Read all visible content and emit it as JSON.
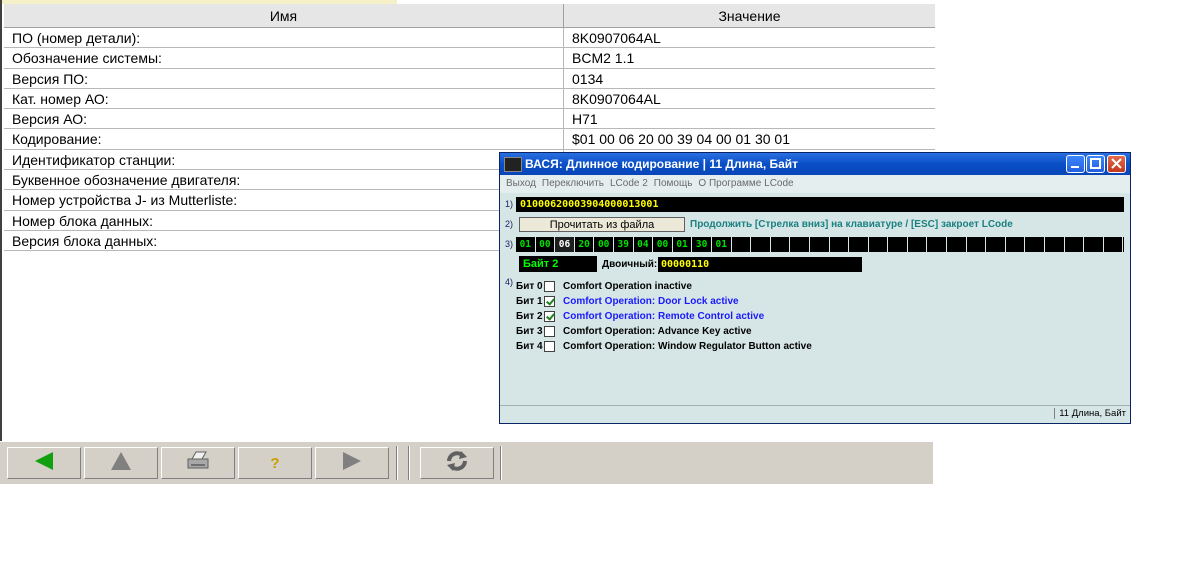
{
  "table": {
    "headers": {
      "name": "Имя",
      "value": "Значение"
    },
    "rows": [
      {
        "name": "ПО (номер детали):",
        "value": "8K0907064AL"
      },
      {
        "name": "Обозначение системы:",
        "value": "BCM2 1.1"
      },
      {
        "name": "Версия ПО:",
        "value": "0134"
      },
      {
        "name": "Кат. номер АО:",
        "value": "8K0907064AL"
      },
      {
        "name": "Версия АО:",
        "value": "H71"
      },
      {
        "name": "Кодирование:",
        "value": "$01 00 06 20 00 39 04 00 01 30 01"
      },
      {
        "name": "Идентификатор станции:",
        "value": ""
      },
      {
        "name": "Буквенное обозначение двигателя:",
        "value": ""
      },
      {
        "name": "Номер устройства J- из Mutterliste:",
        "value": ""
      },
      {
        "name": "Номер блока данных:",
        "value": ""
      },
      {
        "name": "Версия блока данных:",
        "value": ""
      }
    ]
  },
  "toolbar": {
    "icons": [
      "back-arrow-icon",
      "up-arrow-icon",
      "printer-icon",
      "help-icon",
      "forward-arrow-icon",
      "refresh-icon"
    ],
    "help_glyph": "?"
  },
  "dialog": {
    "title": "ВАСЯ: Длинное кодирование    |  11 Длина, Байт",
    "menu": [
      "Выход",
      "Переключить",
      "LCode 2",
      "Помощь",
      "О Программе LCode"
    ],
    "step1_label": "1)",
    "hex_value": "01000620003904000013001",
    "step2_label": "2)",
    "read_button": "Прочитать из файла",
    "hint": "Продолжить [Стрелка вниз] на клавиатуре / [ESC] закроет LCode",
    "step3_label": "3)",
    "bytes": [
      "01",
      "00",
      "06",
      "20",
      "00",
      "39",
      "04",
      "00",
      "01",
      "30",
      "01"
    ],
    "selected_byte_index": 2,
    "byte_label": "Байт 2",
    "binary_label": "Двоичный:",
    "binary_value": "00000110",
    "step4_label": "4)",
    "bits": [
      {
        "bit": "Бит 0",
        "checked": false,
        "desc": "Comfort Operation inactive"
      },
      {
        "bit": "Бит 1",
        "checked": true,
        "desc": "Comfort Operation: Door Lock active"
      },
      {
        "bit": "Бит 2",
        "checked": true,
        "desc": "Comfort Operation: Remote Control active"
      },
      {
        "bit": "Бит 3",
        "checked": false,
        "desc": "Comfort Operation: Advance Key active"
      },
      {
        "bit": "Бит 4",
        "checked": false,
        "desc": "Comfort Operation: Window Regulator Button active"
      }
    ],
    "status": "11 Длина, Байт",
    "colors": {
      "titlebar": "#0a4ec6",
      "background": "#d6e6e6",
      "hex_text": "#ffff00",
      "byte_text": "#00e000",
      "checked_desc": "#1a1aff"
    }
  }
}
